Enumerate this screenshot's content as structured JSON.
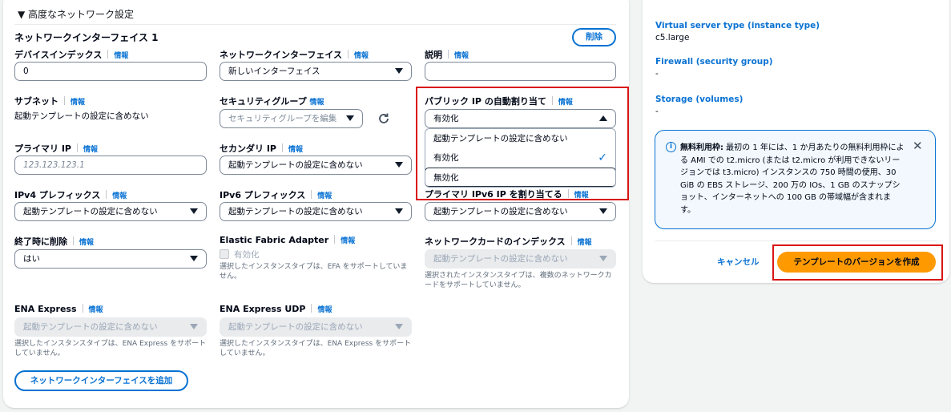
{
  "section": {
    "title": "▼ 高度なネットワーク設定"
  },
  "ni": {
    "title": "ネットワークインターフェイス 1",
    "delete": "削除",
    "info": "情報",
    "device_index": {
      "label": "デバイスインデックス",
      "value": "0"
    },
    "network_interface": {
      "label": "ネットワークインターフェイス",
      "value": "新しいインターフェイス"
    },
    "description": {
      "label": "説明",
      "value": ""
    },
    "subnet": {
      "label": "サブネット",
      "value": "起動テンプレートの設定に含めない"
    },
    "security_group": {
      "label": "セキュリティグループ",
      "placeholder": "セキュリティグループを編集"
    },
    "public_ip": {
      "label": "パブリック IP の自動割り当て",
      "value": "有効化"
    },
    "dropdown": {
      "options": [
        "起動テンプレートの設定に含めない",
        "有効化",
        "無効化"
      ],
      "selected": "有効化"
    },
    "primary_ip": {
      "label": "プライマリ IP",
      "placeholder": "123.123.123.1"
    },
    "secondary_ip": {
      "label": "セカンダリ IP",
      "value": "起動テンプレートの設定に含めない"
    },
    "ipv4_prefix": {
      "label": "IPv4 プレフィックス",
      "value": "起動テンプレートの設定に含めない"
    },
    "ipv6_prefix": {
      "label": "IPv6 プレフィックス",
      "value": "起動テンプレートの設定に含めない"
    },
    "primary_ipv6": {
      "label": "プライマリ IPv6 IP を割り当てる",
      "value": "起動テンプレートの設定に含めない"
    },
    "delete_on_term": {
      "label": "終了時に削除",
      "value": "はい"
    },
    "efa": {
      "label": "Elastic Fabric Adapter",
      "checkbox_label": "有効化",
      "note": "選択したインスタンスタイプは、EFA をサポートしていません。"
    },
    "network_card": {
      "label": "ネットワークカードのインデックス",
      "value": "起動テンプレートの設定に含めない",
      "note": "選択されたインスタンスタイプは、複数のネットワークカードをサポートしていません。"
    },
    "ena_express": {
      "label": "ENA Express",
      "value": "起動テンプレートの設定に含めない",
      "note": "選択したインスタンスタイプは、ENA Express をサポートしていません。"
    },
    "ena_express_udp": {
      "label": "ENA Express UDP",
      "value": "起動テンプレートの設定に含めない",
      "note": "選択したインスタンスタイプは、ENA Express をサポートしていません。"
    },
    "add_button": "ネットワークインターフェイスを追加"
  },
  "summary": {
    "instance_type": {
      "label": "Virtual server type (instance type)",
      "value": "c5.large"
    },
    "firewall": {
      "label": "Firewall (security group)",
      "value": "-"
    },
    "storage": {
      "label": "Storage (volumes)",
      "value": "-"
    },
    "alert": {
      "bold": "無料利用枠:",
      "text": " 最初の 1 年には、1 か月あたりの無料利用枠による AMI での t2.micro (または t2.micro が利用できないリージョンでは t3.micro) インスタンスの 750 時間の使用、30 GiB の EBS ストレージ、200 万の IOs、1 GB のスナップショット、インターネットへの 100 GB の帯域幅が含まれます。"
    },
    "cancel": "キャンセル",
    "create": "テンプレートのバージョンを作成"
  },
  "colors": {
    "accent": "#0972d3",
    "primary_button": "#ff9900",
    "highlight_border": "#d91515"
  }
}
